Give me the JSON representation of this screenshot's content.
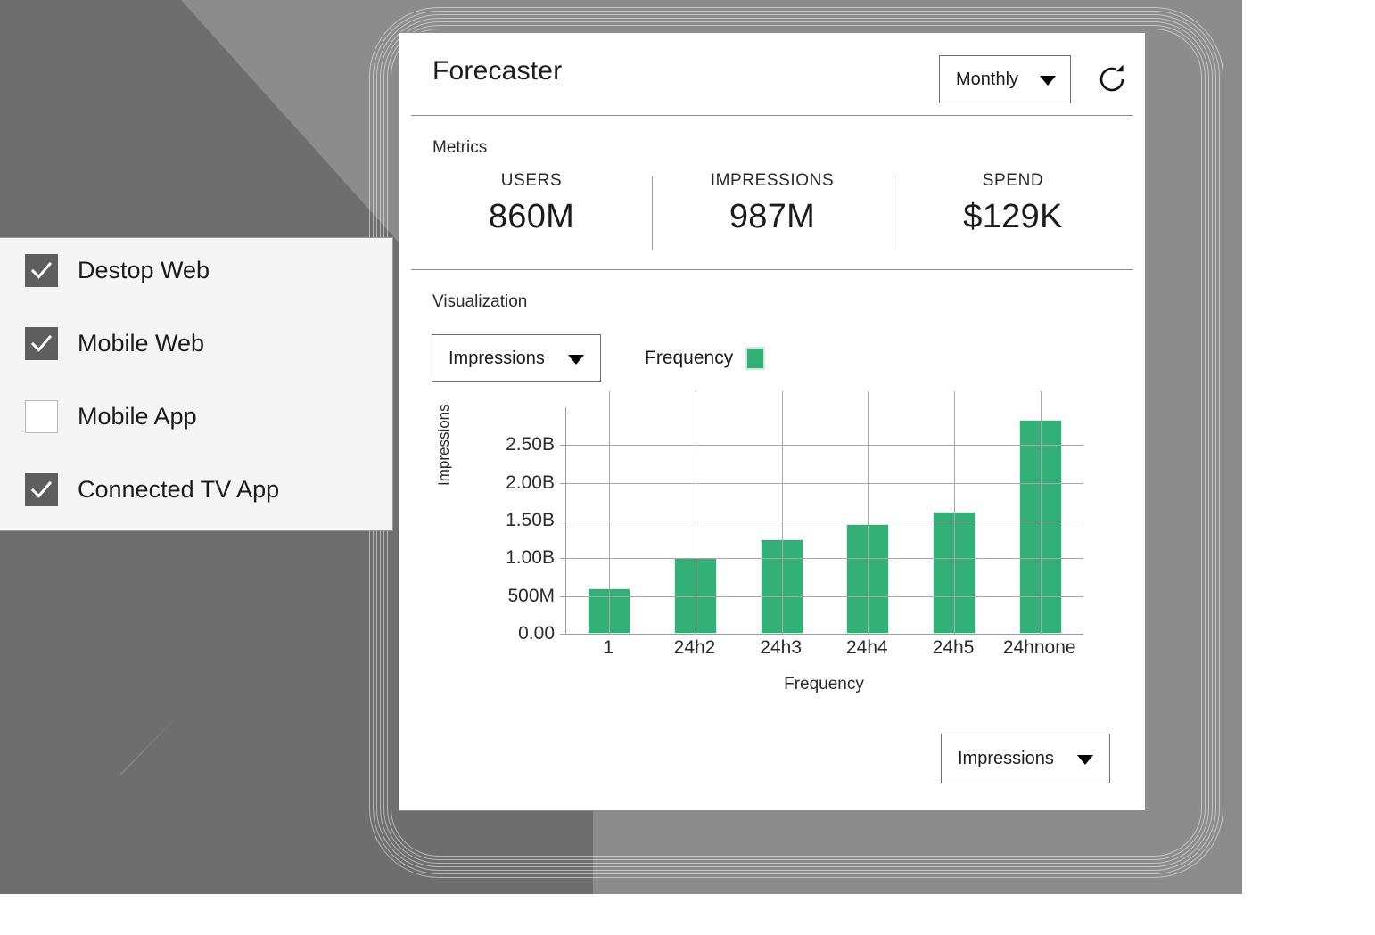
{
  "app": {
    "title": "Forecaster",
    "period_selector": {
      "value": "Monthly",
      "icon": "chevron-down-icon"
    },
    "refresh": {
      "icon": "refresh-icon"
    }
  },
  "metrics": {
    "section_label": "Metrics",
    "items": [
      {
        "name": "USERS",
        "value": "860M"
      },
      {
        "name": "IMPRESSIONS",
        "value": "987M"
      },
      {
        "name": "SPEND",
        "value": "$129K"
      }
    ]
  },
  "visualization": {
    "section_label": "Visualization",
    "metric_selector": {
      "value": "Impressions",
      "icon": "chevron-down-icon"
    },
    "legend": {
      "label": "Frequency",
      "swatch_color": "#33b077"
    },
    "footer_selector": {
      "value": "Impressions",
      "icon": "chevron-down-icon"
    }
  },
  "chart_data": {
    "type": "bar",
    "title": "",
    "categories": [
      "1",
      "24h2",
      "24h3",
      "24h4",
      "24h5",
      "24hnone"
    ],
    "values": [
      600000000,
      1000000000,
      1250000000,
      1450000000,
      1620000000,
      2830000000
    ],
    "value_labels": [
      "600M",
      "1.00B",
      "1.25B",
      "1.45B",
      "1.62B",
      "2.83B"
    ],
    "series": [
      {
        "name": "Frequency",
        "color": "#33b077",
        "values": [
          600000000,
          1000000000,
          1250000000,
          1450000000,
          1620000000,
          2830000000
        ]
      }
    ],
    "xlabel": "Frequency",
    "ylabel": "Impressions",
    "ylim": [
      0,
      3000000000
    ],
    "ytick_values": [
      0,
      500000000,
      1000000000,
      1500000000,
      2000000000,
      2500000000
    ],
    "ytick_labels": [
      "0.00",
      "500M",
      "1.00B",
      "1.50B",
      "2.00B",
      "2.50B"
    ],
    "grid": true,
    "legend_position": "top"
  },
  "channel_filter": {
    "items": [
      {
        "label": "Destop Web",
        "checked": true
      },
      {
        "label": "Mobile Web",
        "checked": true
      },
      {
        "label": "Mobile App",
        "checked": false
      },
      {
        "label": "Connected TV App",
        "checked": true
      }
    ]
  },
  "theme": {
    "accent": "#33b077",
    "bg_light": "#8c8c8c",
    "bg_dark": "#6e6e6e",
    "card_bg": "#ffffff",
    "panel_bg": "#f5f5f5"
  }
}
